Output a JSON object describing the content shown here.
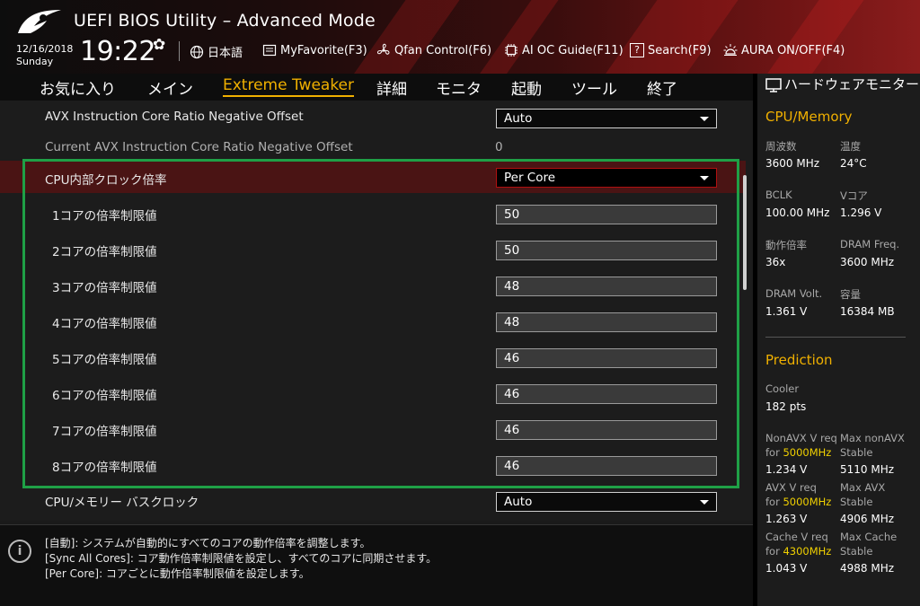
{
  "app": {
    "title": "UEFI BIOS Utility – Advanced Mode",
    "date": "12/16/2018",
    "day": "Sunday",
    "time": "19:22"
  },
  "toolbar": {
    "language": "日本語",
    "myfavorite": "MyFavorite(F3)",
    "qfan": "Qfan Control(F6)",
    "aioc": "AI OC Guide(F11)",
    "search": "Search(F9)",
    "aura": "AURA ON/OFF(F4)"
  },
  "tabs": [
    {
      "label": "お気に入り"
    },
    {
      "label": "メイン"
    },
    {
      "label": "Extreme Tweaker",
      "active": true
    },
    {
      "label": "詳細"
    },
    {
      "label": "モニタ"
    },
    {
      "label": "起動"
    },
    {
      "label": "ツール"
    },
    {
      "label": "終了"
    }
  ],
  "settings": {
    "avx_offset": {
      "label": "AVX Instruction Core Ratio Negative Offset",
      "value": "Auto"
    },
    "current_avx": {
      "label": "Current AVX Instruction Core Ratio Negative Offset",
      "value": "0"
    },
    "cpu_ratio": {
      "label": "CPU内部クロック倍率",
      "value": "Per Core"
    },
    "cores": [
      {
        "label": "1コアの倍率制限値",
        "value": "50"
      },
      {
        "label": "2コアの倍率制限値",
        "value": "50"
      },
      {
        "label": "3コアの倍率制限値",
        "value": "48"
      },
      {
        "label": "4コアの倍率制限値",
        "value": "48"
      },
      {
        "label": "5コアの倍率制限値",
        "value": "46"
      },
      {
        "label": "6コアの倍率制限値",
        "value": "46"
      },
      {
        "label": "7コアの倍率制限値",
        "value": "46"
      },
      {
        "label": "8コアの倍率制限値",
        "value": "46"
      }
    ],
    "bclk": {
      "label": "CPU/メモリー バスクロック",
      "value": "Auto"
    }
  },
  "help": {
    "lines": [
      "[自動]: システムが自動的にすべてのコアの動作倍率を調整します。",
      "[Sync All Cores]: コア動作倍率制限値を設定し、すべてのコアに同期させます。",
      "[Per Core]: コアごとに動作倍率制限値を設定します。"
    ]
  },
  "monitor": {
    "title": "ハードウェアモニター",
    "section_cpu": "CPU/Memory",
    "freq_label": "周波数",
    "freq": "3600 MHz",
    "temp_label": "温度",
    "temp": "24°C",
    "bclk_label": "BCLK",
    "bclk": "100.00 MHz",
    "vcore_label": "Vコア",
    "vcore": "1.296 V",
    "ratio_label": "動作倍率",
    "ratio": "36x",
    "dramf_label": "DRAM Freq.",
    "dramf": "3600 MHz",
    "dramv_label": "DRAM Volt.",
    "dramv": "1.361 V",
    "cap_label": "容量",
    "cap": "16384 MB",
    "section_pred": "Prediction",
    "cooler_label": "Cooler",
    "cooler": "182 pts",
    "nonavx_req_label": "NonAVX V req",
    "for_label": "for",
    "nonavx_freq": "5000MHz",
    "nonavx_req": "1.234 V",
    "max_nonavx_label": "Max nonAVX",
    "stable_label": "Stable",
    "max_nonavx": "5110 MHz",
    "avx_req_label": "AVX V req",
    "avx_freq": "5000MHz",
    "avx_req": "1.263 V",
    "max_avx_label": "Max AVX",
    "max_avx": "4906 MHz",
    "cache_req_label": "Cache V req",
    "cache_freq": "4300MHz",
    "cache_req": "1.043 V",
    "max_cache_label": "Max Cache",
    "max_cache": "4988 MHz"
  },
  "colors": {
    "accent": "#f0b000",
    "highlight": "#1fa046",
    "selected_row": "#4a1414"
  }
}
